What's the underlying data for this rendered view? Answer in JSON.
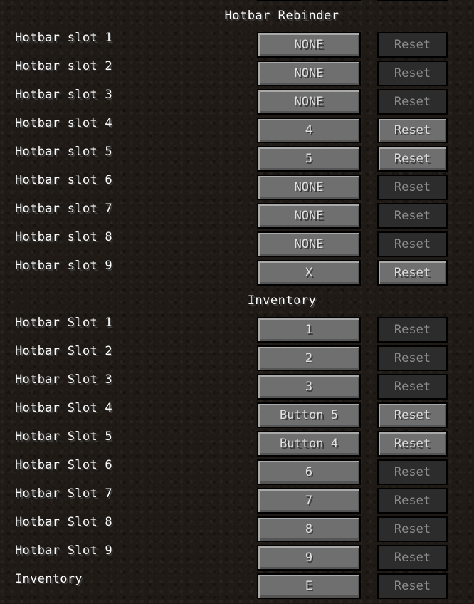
{
  "sections": [
    {
      "title": "Hotbar Rebinder",
      "rows": [
        {
          "label": "Hotbar slot 1",
          "key": "NONE",
          "reset": "Reset",
          "reset_enabled": false
        },
        {
          "label": "Hotbar slot 2",
          "key": "NONE",
          "reset": "Reset",
          "reset_enabled": false
        },
        {
          "label": "Hotbar slot 3",
          "key": "NONE",
          "reset": "Reset",
          "reset_enabled": false
        },
        {
          "label": "Hotbar slot 4",
          "key": "4",
          "reset": "Reset",
          "reset_enabled": true
        },
        {
          "label": "Hotbar slot 5",
          "key": "5",
          "reset": "Reset",
          "reset_enabled": true
        },
        {
          "label": "Hotbar slot 6",
          "key": "NONE",
          "reset": "Reset",
          "reset_enabled": false
        },
        {
          "label": "Hotbar slot 7",
          "key": "NONE",
          "reset": "Reset",
          "reset_enabled": false
        },
        {
          "label": "Hotbar slot 8",
          "key": "NONE",
          "reset": "Reset",
          "reset_enabled": false
        },
        {
          "label": "Hotbar slot 9",
          "key": "X",
          "reset": "Reset",
          "reset_enabled": true
        }
      ]
    },
    {
      "title": "Inventory",
      "rows": [
        {
          "label": "Hotbar Slot 1",
          "key": "1",
          "reset": "Reset",
          "reset_enabled": false
        },
        {
          "label": "Hotbar Slot 2",
          "key": "2",
          "reset": "Reset",
          "reset_enabled": false
        },
        {
          "label": "Hotbar Slot 3",
          "key": "3",
          "reset": "Reset",
          "reset_enabled": false
        },
        {
          "label": "Hotbar Slot 4",
          "key": "Button 5",
          "reset": "Reset",
          "reset_enabled": true
        },
        {
          "label": "Hotbar Slot 5",
          "key": "Button 4",
          "reset": "Reset",
          "reset_enabled": true
        },
        {
          "label": "Hotbar Slot 6",
          "key": "6",
          "reset": "Reset",
          "reset_enabled": false
        },
        {
          "label": "Hotbar Slot 7",
          "key": "7",
          "reset": "Reset",
          "reset_enabled": false
        },
        {
          "label": "Hotbar Slot 8",
          "key": "8",
          "reset": "Reset",
          "reset_enabled": false
        },
        {
          "label": "Hotbar Slot 9",
          "key": "9",
          "reset": "Reset",
          "reset_enabled": false
        },
        {
          "label": "Inventory",
          "key": "E",
          "reset": "Reset",
          "reset_enabled": false
        }
      ]
    }
  ]
}
